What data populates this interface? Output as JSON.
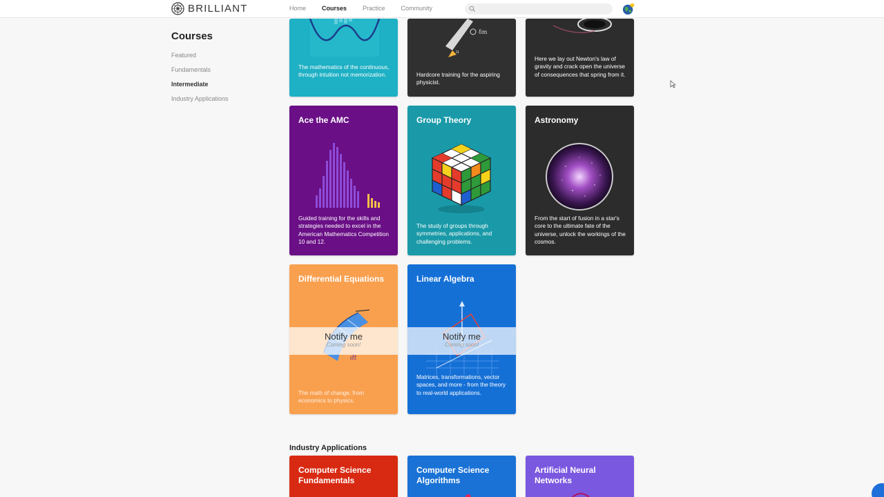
{
  "brand": {
    "name": "BRILLIANT"
  },
  "nav": {
    "links": [
      "Home",
      "Courses",
      "Practice",
      "Community"
    ],
    "active": "Courses"
  },
  "search": {
    "placeholder": ""
  },
  "sidebar": {
    "title": "Courses",
    "items": [
      {
        "label": "Featured",
        "active": false
      },
      {
        "label": "Fundamentals",
        "active": false
      },
      {
        "label": "Intermediate",
        "active": true
      },
      {
        "label": "Industry Applications",
        "active": false
      }
    ]
  },
  "top_row": [
    {
      "desc": "The mathematics of the continuous, through intuition not memorization.",
      "color": "#1eb0c4"
    },
    {
      "desc": "Hardcore training for the aspiring physicist.",
      "color": "#303030"
    },
    {
      "desc": "Here we lay out Newton's law of gravity and crack open the universe of consequences that spring from it.",
      "color": "#2d2d2d"
    }
  ],
  "courses": [
    {
      "title": "Ace the AMC",
      "desc": "Guided training for the skills and strategies needed to excel in the American Mathematics Competition 10 and 12.",
      "color": "#6a0f86"
    },
    {
      "title": "Group Theory",
      "desc": "The study of groups through symmetries, applications, and challenging problems.",
      "color": "#1a9aa8"
    },
    {
      "title": "Astronomy",
      "desc": "From the start of fusion in a star's core to the ultimate fate of the universe, unlock the workings of the cosmos.",
      "color": "#2c2c2c"
    },
    {
      "title": "Differential Equations",
      "desc": "The math of change, from economics to physics.",
      "color": "#f9a04f"
    },
    {
      "title": "Linear Algebra",
      "desc": "Matrices, transformations, vector spaces, and more - from the theory to real-world applications.",
      "color": "#1570d6"
    }
  ],
  "notify": {
    "label": "Notify me",
    "sub": "Coming soon!"
  },
  "industry": {
    "heading": "Industry Applications",
    "courses": [
      {
        "title": "Computer Science Fundamentals",
        "color": "#d82a12"
      },
      {
        "title": "Computer Science Algorithms",
        "color": "#1a72d6"
      },
      {
        "title": "Artificial Neural Networks",
        "color": "#7b58e0"
      }
    ]
  }
}
